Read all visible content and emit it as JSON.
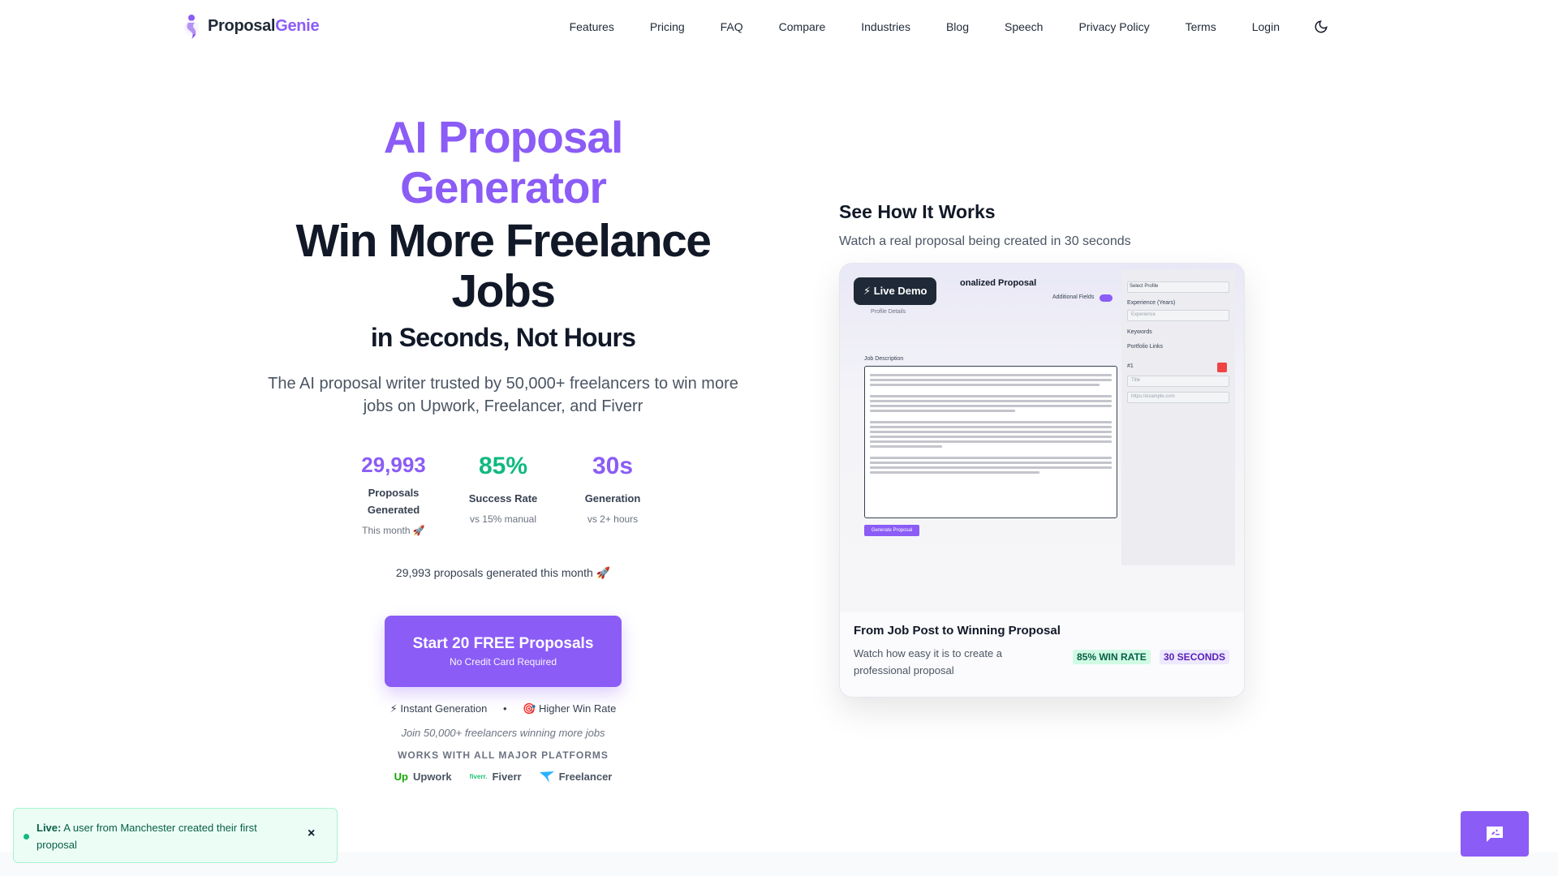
{
  "brand": {
    "name_part1": "Proposal",
    "name_part2": "Genie"
  },
  "nav": {
    "links": [
      "Features",
      "Pricing",
      "FAQ",
      "Compare",
      "Industries",
      "Blog",
      "Speech",
      "Privacy Policy",
      "Terms",
      "Login"
    ]
  },
  "hero": {
    "title_line1": "AI Proposal",
    "title_line2": "Generator",
    "headline_line1": "Win More Freelance",
    "headline_line2": "Jobs",
    "subheadline": "in Seconds, Not Hours",
    "lead": "The AI proposal writer trusted by 50,000+ freelancers to win more jobs on Upwork, Freelancer, and Fiverr"
  },
  "stats": [
    {
      "value": "29,993",
      "label": "Proposals Generated",
      "sub": "This month 🚀"
    },
    {
      "value": "85%",
      "label": "Success Rate",
      "sub": "vs 15% manual"
    },
    {
      "value": "30s",
      "label": "Generation",
      "sub": "vs 2+ hours"
    }
  ],
  "month_line": "29,993 proposals generated this month 🚀",
  "cta": {
    "title": "Start 20 FREE Proposals",
    "subtitle": "No Credit Card Required"
  },
  "features": {
    "item1": "⚡ Instant Generation",
    "separator": "•",
    "item2": "🎯 Higher Win Rate"
  },
  "join": "Join 50,000+ freelancers winning more jobs",
  "works_with": "WORKS WITH ALL MAJOR PLATFORMS",
  "platforms": [
    {
      "name": "Upwork",
      "icon": "up"
    },
    {
      "name": "Fiverr",
      "icon": "fiverr"
    },
    {
      "name": "Freelancer",
      "icon": "bird"
    }
  ],
  "demo": {
    "title": "See How It Works",
    "subtitle": "Watch a real proposal being created in 30 seconds",
    "badge": "⚡ Live Demo",
    "mock_title": "onalized Proposal",
    "mock_labels": {
      "additional_fields": "Additional Fields",
      "profile_details": "Profile Details",
      "job_description": "Job Description",
      "select_profile": "Select Profile",
      "experience": "Experience (Years)",
      "experience_placeholder": "Experience",
      "keywords": "Keywords",
      "portfolio_links": "Portfolio Links",
      "item_number": "#1",
      "title_placeholder": "Title",
      "url_placeholder": "https://example.com",
      "generate": "Generate Proposal"
    },
    "foot_title": "From Job Post to Winning Proposal",
    "foot_desc": "Watch how easy it is to create a professional proposal",
    "pill_win": "85% WIN RATE",
    "pill_time": "30 SECONDS"
  },
  "toast": {
    "prefix": "Live:",
    "message": "A user from Manchester created their first proposal",
    "close": "×"
  },
  "colors": {
    "accent": "#8b5cf6",
    "success": "#10b981",
    "dark": "#111827"
  }
}
